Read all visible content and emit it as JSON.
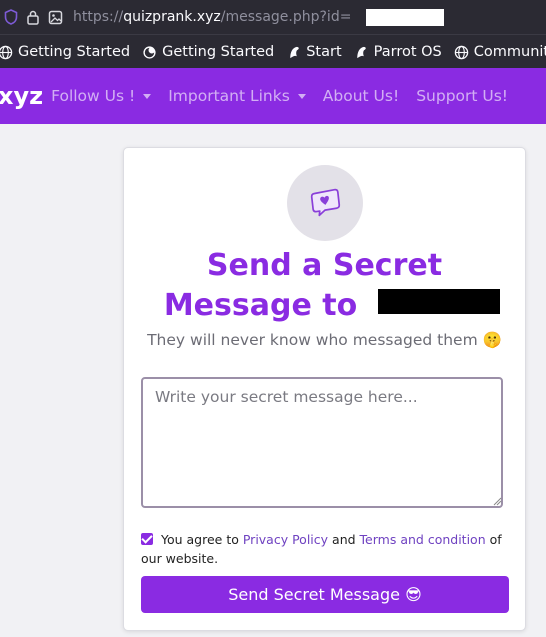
{
  "browser": {
    "url_prefix": "https://",
    "url_host": "quizprank.xyz",
    "url_path": "/message.php?id="
  },
  "bookmarks": [
    {
      "label": "Getting Started",
      "icon": "globe-icon"
    },
    {
      "label": "Getting Started",
      "icon": "firefox-icon"
    },
    {
      "label": "Start",
      "icon": "parrot-icon"
    },
    {
      "label": "Parrot OS",
      "icon": "parrot-icon"
    },
    {
      "label": "Community",
      "icon": "globe-icon"
    }
  ],
  "navbar": {
    "brand": "xyz",
    "items": [
      {
        "label": "Follow Us !"
      },
      {
        "label": "Important Links"
      },
      {
        "label": "About Us!"
      },
      {
        "label": "Support Us!"
      }
    ],
    "color": "#8a2be2"
  },
  "card": {
    "title_line1": "Send a Secret",
    "title_line2": "Message to",
    "subtitle": "They will never know who messaged them 🤫",
    "message_placeholder": "Write your secret message here...",
    "agree_prefix": "You agree to",
    "privacy_link": "Privacy Policy",
    "agree_and": "and",
    "terms_link": "Terms and condition",
    "agree_suffix": "of our website.",
    "agree_checked": true,
    "send_button": "Send Secret Message 😎"
  }
}
